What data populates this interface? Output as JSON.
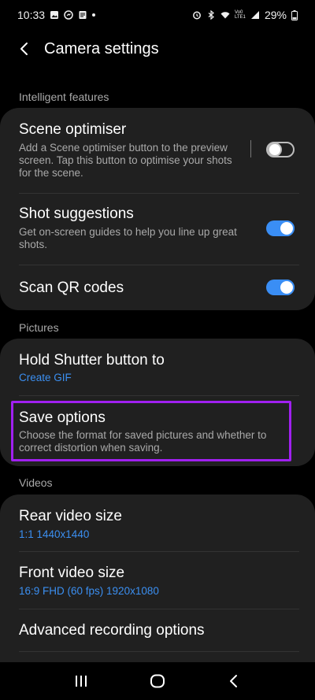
{
  "status_bar": {
    "time": "10:33",
    "battery": "29%",
    "network": "Vo0 LTE1"
  },
  "header": {
    "title": "Camera settings"
  },
  "sections": {
    "intelligent": {
      "label": "Intelligent features",
      "scene_optimiser": {
        "title": "Scene optimiser",
        "desc": "Add a Scene optimiser button to the preview screen. Tap this button to optimise your shots for the scene.",
        "enabled": false
      },
      "shot_suggestions": {
        "title": "Shot suggestions",
        "desc": "Get on-screen guides to help you line up great shots.",
        "enabled": true
      },
      "scan_qr": {
        "title": "Scan QR codes",
        "enabled": true
      }
    },
    "pictures": {
      "label": "Pictures",
      "hold_shutter": {
        "title": "Hold Shutter button to",
        "value": "Create GIF"
      },
      "save_options": {
        "title": "Save options",
        "desc": "Choose the format for saved pictures and whether to correct distortion when saving."
      }
    },
    "videos": {
      "label": "Videos",
      "rear_video": {
        "title": "Rear video size",
        "value": "1:1 1440x1440"
      },
      "front_video": {
        "title": "Front video size",
        "value": "16:9 FHD (60 fps) 1920x1080"
      },
      "advanced": {
        "title": "Advanced recording options"
      }
    }
  },
  "colors": {
    "accent": "#3a8ef5",
    "highlight": "#a020f0",
    "card": "#202020"
  }
}
